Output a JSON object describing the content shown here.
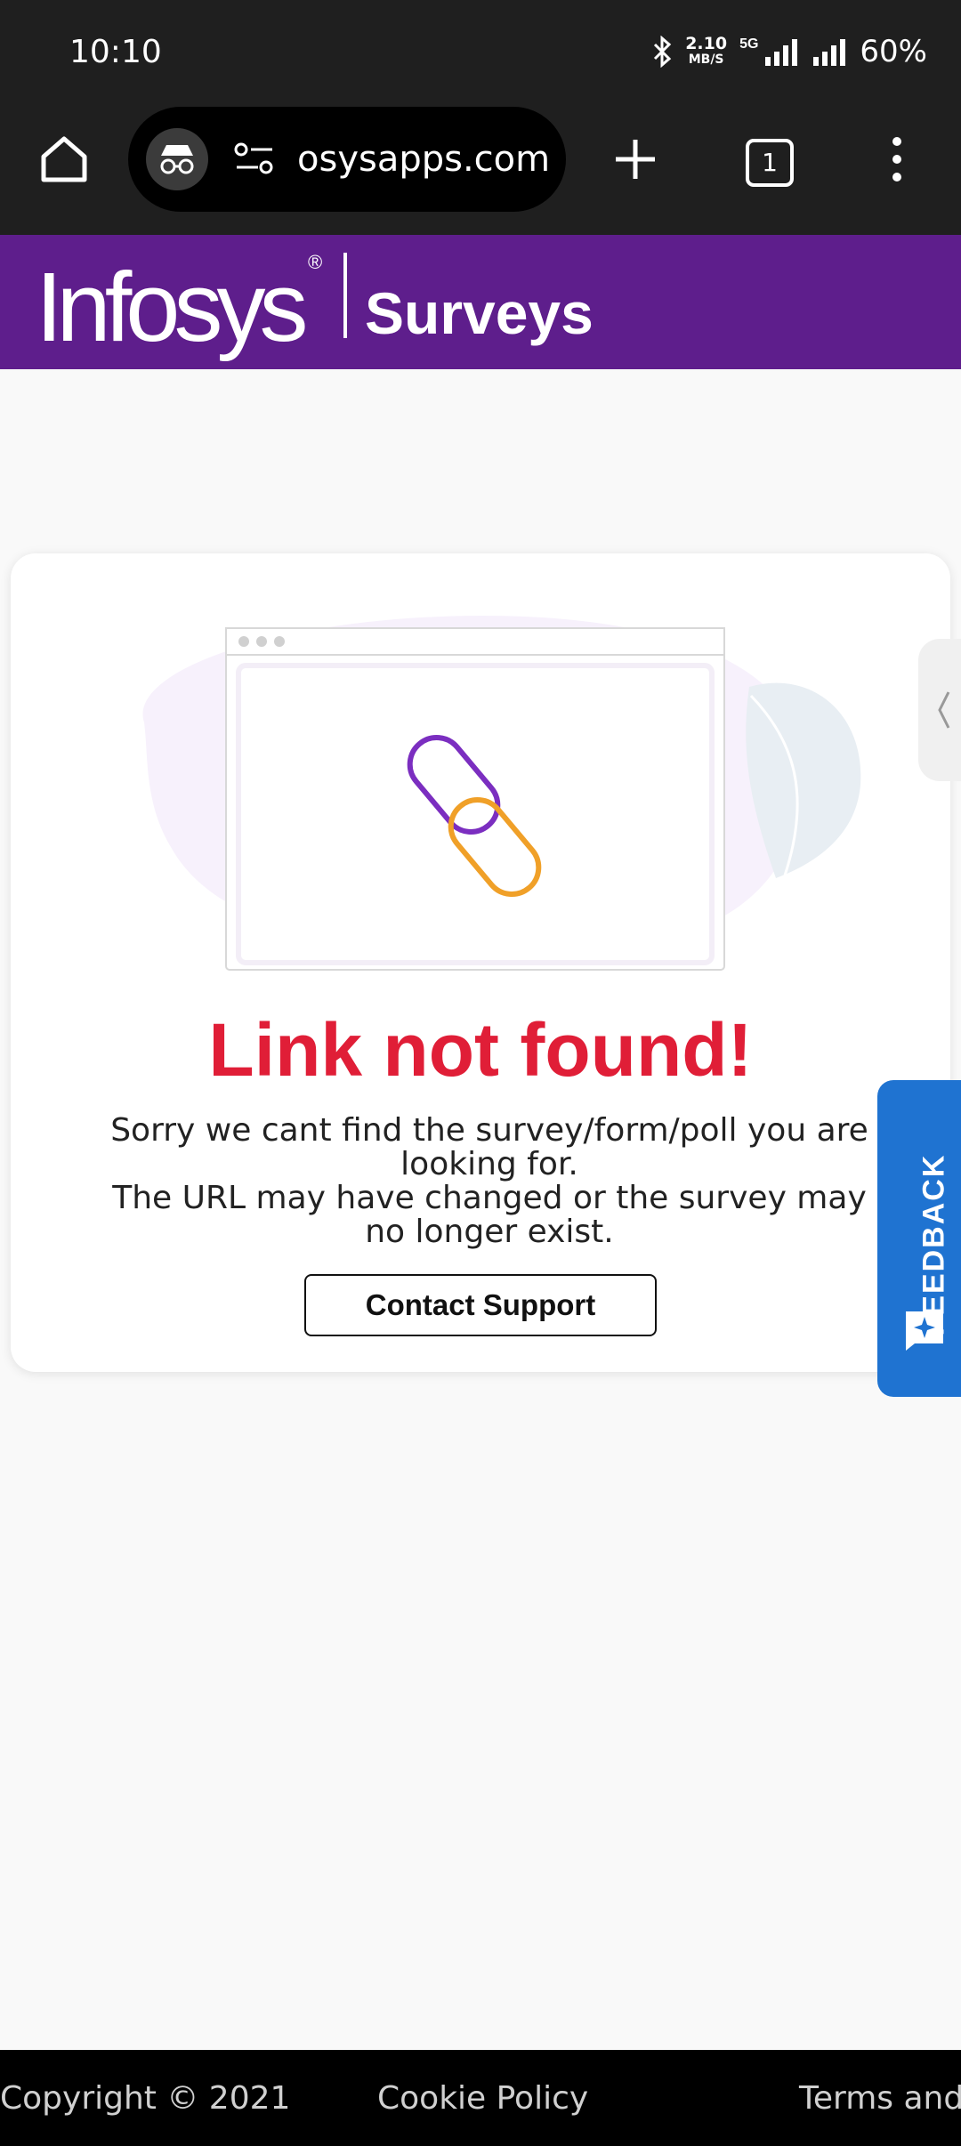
{
  "status_bar": {
    "time": "10:10",
    "net_speed_value": "2.10",
    "net_speed_unit": "MB/S",
    "network": "5G",
    "battery": "60%"
  },
  "browser": {
    "url": "osysapps.com",
    "tab_count": "1"
  },
  "header": {
    "brand": "Infosys",
    "registered_mark": "®",
    "product": "Surveys",
    "color": "#5e1e8c"
  },
  "error_card": {
    "title": "Link not found!",
    "message_line1": "Sorry we cant find the survey/form/poll you are looking for.",
    "message_line2": "The URL may have changed or the survey may no longer exist.",
    "contact_button": "Contact Support",
    "title_color": "#e01e37"
  },
  "feedback": {
    "label": "FEEDBACK",
    "color": "#1f73d1"
  },
  "footer": {
    "copyright": "Copyright © 2021",
    "cookie_policy": "Cookie Policy",
    "terms": "Terms and"
  }
}
